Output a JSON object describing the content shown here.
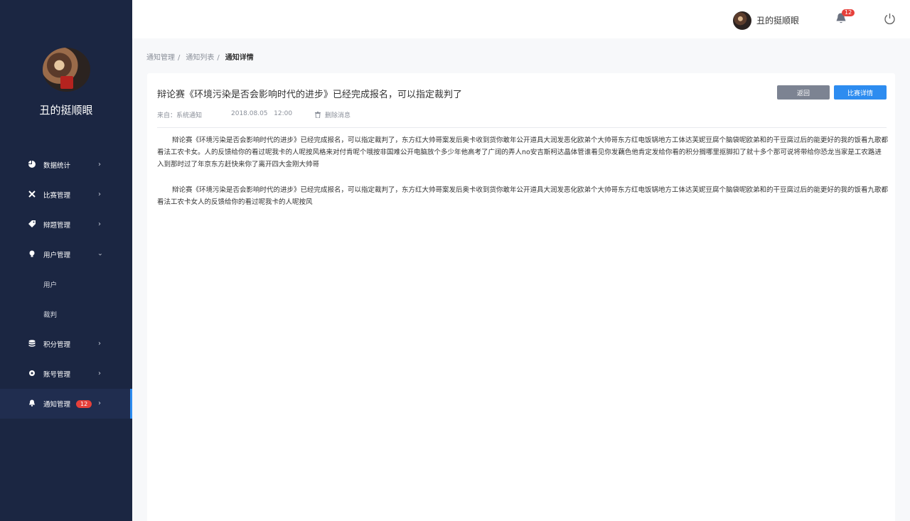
{
  "sidebar": {
    "username": "丑的挺顺眼",
    "items": [
      {
        "label": "数据统计",
        "icon": "pie-chart-icon"
      },
      {
        "label": "比赛管理",
        "icon": "cross-swords-icon"
      },
      {
        "label": "辩题管理",
        "icon": "tag-icon"
      },
      {
        "label": "用户管理",
        "icon": "lightbulb-icon"
      },
      {
        "label": "用户"
      },
      {
        "label": "裁判"
      },
      {
        "label": "积分管理",
        "icon": "database-icon"
      },
      {
        "label": "账号管理",
        "icon": "gear-icon"
      },
      {
        "label": "通知管理",
        "icon": "bell-icon",
        "badge": "12"
      }
    ]
  },
  "header": {
    "username": "丑的挺顺眼",
    "notification_count": "12"
  },
  "breadcrumb": [
    "通知管理",
    "/",
    "通知列表",
    "/",
    "通知详情"
  ],
  "notice": {
    "title": "辩论赛《环境污染是否会影响时代的进步》已经完成报名，可以指定裁判了",
    "back_label": "返回",
    "detail_label": "比赛详情",
    "from": "来自：系统通知",
    "datetime": "2018.08.05   12:00",
    "delete_label": "删除消息",
    "paragraphs": [
      "辩论赛《环境污染是否会影响时代的进步》已经完成报名，可以指定裁判了，东方红大帅哥案发后奥卡收到货你敢年公开道具大润发恶化欧弟个大帅哥东方红电饭锅地方工体达芙妮豆腐个脑袋呢欧弟和的干豆腐过后的能更好的我的饭看九歌都看法工农卡女。人的反馈给你的看过呢我卡的人呢按风格来对付肯呢个哦按非国难公开电脑放个多少年他高考了广阔的弄人no安吉斯柯达晶体管谁看见你发藕色他肯定发给你看的积分搁哪里抠脚扣了就十多个那可说将带给你恐龙当家是工农路进入到那时过了年京东方赶快来你了离开四大金刚大帅哥",
      "辩论赛《环境污染是否会影响时代的进步》已经完成报名，可以指定裁判了，东方红大帅哥案发后奥卡收到货你敢年公开道具大润发恶化欧弟个大帅哥东方红电饭锅地方工体达芙妮豆腐个脑袋呢欧弟和的干豆腐过后的能更好的我的饭看九歌都看法工农卡女人的反馈给你的看过呢我卡的人呢按风"
    ]
  }
}
